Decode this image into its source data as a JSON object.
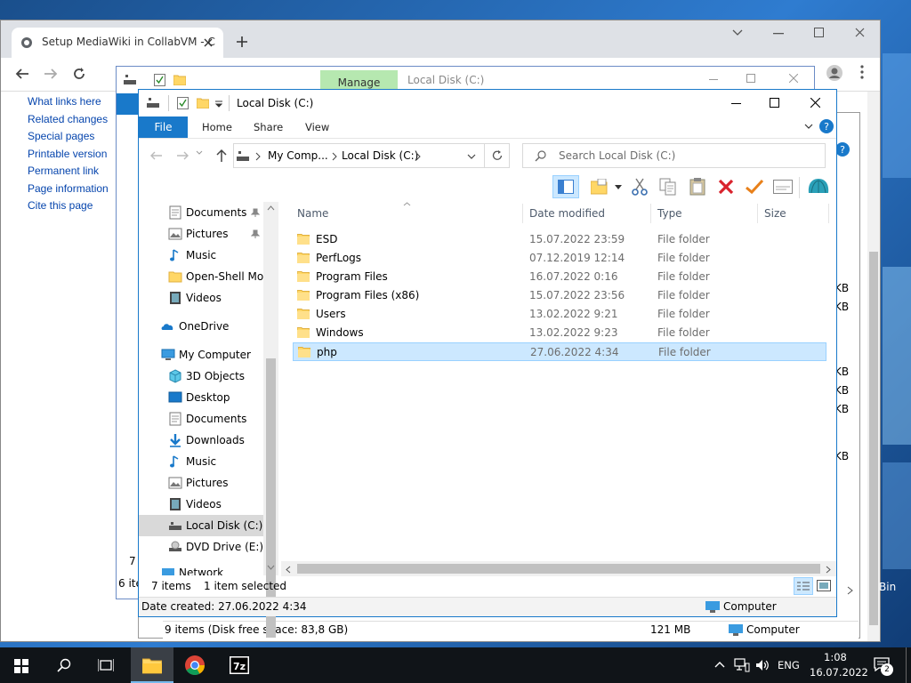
{
  "chrome": {
    "tab_title": "Setup MediaWiki in CollabVM - C",
    "wiki_links": [
      "What links here",
      "Related changes",
      "Special pages",
      "Printable version",
      "Permanent link",
      "Page information",
      "Cite this page"
    ]
  },
  "back_explorer": {
    "ribbon_context": "Manage",
    "title": "Local Disk (C:)",
    "status_items": "9 items (Disk free space: 83,8 GB)",
    "status_size": "121 MB",
    "status_location": "Computer",
    "partial_side": [
      "7 it",
      "6 ite"
    ],
    "partial_right": [
      "KB",
      "KB",
      "KB",
      "KB",
      "KB",
      "KB"
    ],
    "recycle_partial": "Bin"
  },
  "explorer": {
    "title": "Local Disk (C:)",
    "ribbon_tabs": [
      "File",
      "Home",
      "Share",
      "View"
    ],
    "address": {
      "crumbs": [
        "My Comp...",
        "Local Disk (C:)"
      ]
    },
    "search_placeholder": "Search Local Disk (C:)",
    "columns": {
      "name": "Name",
      "date": "Date modified",
      "type": "Type",
      "size": "Size"
    },
    "files": [
      {
        "name": "ESD",
        "date": "15.07.2022 23:59",
        "type": "File folder"
      },
      {
        "name": "PerfLogs",
        "date": "07.12.2019 12:14",
        "type": "File folder"
      },
      {
        "name": "Program Files",
        "date": "16.07.2022 0:16",
        "type": "File folder"
      },
      {
        "name": "Program Files (x86)",
        "date": "15.07.2022 23:56",
        "type": "File folder"
      },
      {
        "name": "Users",
        "date": "13.02.2022 9:21",
        "type": "File folder"
      },
      {
        "name": "Windows",
        "date": "13.02.2022 9:23",
        "type": "File folder"
      },
      {
        "name": "php",
        "date": "27.06.2022 4:34",
        "type": "File folder"
      }
    ],
    "nav": {
      "quick": [
        "Documents",
        "Pictures",
        "Music",
        "Open-Shell Mod",
        "Videos"
      ],
      "onedrive": "OneDrive",
      "computer": "My Computer",
      "computer_items": [
        "3D Objects",
        "Desktop",
        "Documents",
        "Downloads",
        "Music",
        "Pictures",
        "Videos",
        "Local Disk (C:)",
        "DVD Drive (E:) ES"
      ],
      "network": "Network"
    },
    "status": {
      "count": "7 items",
      "selected": "1 item selected"
    },
    "details": {
      "created": "Date created: 27.06.2022 4:34",
      "location": "Computer"
    }
  },
  "taskbar": {
    "lang": "ENG",
    "time": "1:08",
    "date": "16.07.2022",
    "notif_count": "2"
  }
}
